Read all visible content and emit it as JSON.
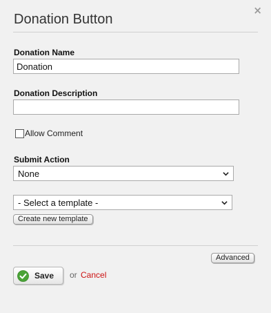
{
  "dialog": {
    "title": "Donation Button",
    "close_icon": "close-icon",
    "close_glyph": "×"
  },
  "form": {
    "name_label": "Donation Name",
    "name_value": "Donation",
    "description_label": "Donation Description",
    "description_value": "",
    "allow_comment_label": "Allow Comment",
    "allow_comment_checked": false,
    "submit_action_label": "Submit Action",
    "submit_action_selected": "None",
    "template_selected": "- Select a template -",
    "create_template_label": "Create new template"
  },
  "footer": {
    "advanced_label": "Advanced",
    "save_label": "Save",
    "save_icon": "checkmark-icon",
    "or_text": "or",
    "cancel_label": "Cancel"
  },
  "colors": {
    "background": "#f1f1f1",
    "save_icon_green": "#4aa337",
    "cancel_red": "#cc1111"
  }
}
